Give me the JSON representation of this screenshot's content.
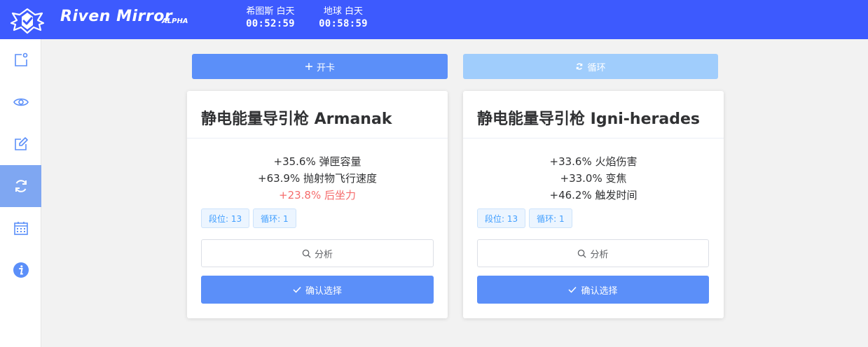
{
  "header": {
    "brand": "Riven Mirror",
    "brand_tag": "ALPHA",
    "timers": [
      {
        "label": "希图斯 白天",
        "value": "00:52:59"
      },
      {
        "label": "地球 白天",
        "value": "00:58:59"
      }
    ]
  },
  "sidebar": {
    "items": [
      {
        "icon": "new-card-icon",
        "active": false
      },
      {
        "icon": "eye-icon",
        "active": false
      },
      {
        "icon": "edit-icon",
        "active": false
      },
      {
        "icon": "refresh-icon",
        "active": true
      },
      {
        "icon": "calendar-icon",
        "active": false
      },
      {
        "icon": "info-icon",
        "active": false
      }
    ]
  },
  "actions": {
    "open_label": "开卡",
    "loop_label": "循环"
  },
  "cards": [
    {
      "title": "静电能量导引枪 Armanak",
      "stats": [
        {
          "text": "+35.6% 弹匣容量",
          "negative": false
        },
        {
          "text": "+63.9% 抛射物飞行速度",
          "negative": false
        },
        {
          "text": "+23.8% 后坐力",
          "negative": true
        }
      ],
      "tags": [
        "段位: 13",
        "循环: 1"
      ],
      "analyze_label": "分析",
      "confirm_label": "确认选择"
    },
    {
      "title": "静电能量导引枪 Igni-herades",
      "stats": [
        {
          "text": "+33.6% 火焰伤害",
          "negative": false
        },
        {
          "text": "+33.0% 变焦",
          "negative": false
        },
        {
          "text": "+46.2% 触发时间",
          "negative": false
        }
      ],
      "tags": [
        "段位: 13",
        "循环: 1"
      ],
      "analyze_label": "分析",
      "confirm_label": "确认选择"
    }
  ],
  "colors": {
    "header": "#3d5afe",
    "primary": "#5b8ff9",
    "primary_light": "#a0cdfc",
    "negative": "#f56c6c",
    "tag_text": "#409eff"
  }
}
